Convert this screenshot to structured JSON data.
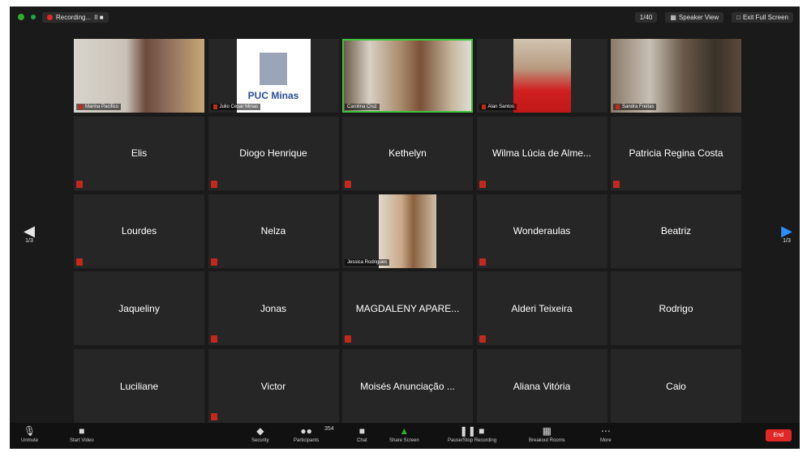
{
  "window": {
    "recording_label": "Recording...",
    "recording_controls": "II ■",
    "page_indicator": "1/40",
    "speaker_view_label": "Speaker View",
    "exit_full_screen_label": "Exit Full Screen"
  },
  "navigation": {
    "left_page": "1/3",
    "right_page": "1/3"
  },
  "participants": [
    {
      "name": "Marina Pacifico",
      "video": true
    },
    {
      "name": "Julio Cesar Minas",
      "video": true,
      "logo_text": "PUC Minas"
    },
    {
      "name": "Carolina Cruz",
      "video": true,
      "active_speaker": true
    },
    {
      "name": "Alan Santos",
      "video": true
    },
    {
      "name": "Sandra Freitas",
      "video": true
    },
    {
      "name": "Elis",
      "video": false
    },
    {
      "name": "Diogo Henrique",
      "video": false
    },
    {
      "name": "Kethelyn",
      "video": false
    },
    {
      "name": "Wilma Lúcia de Alme...",
      "video": false
    },
    {
      "name": "Patricia Regina Costa",
      "video": false
    },
    {
      "name": "Lourdes",
      "video": false
    },
    {
      "name": "Nelza",
      "video": false
    },
    {
      "name": "Jessica Rodrigues",
      "video": true
    },
    {
      "name": "Wonderaulas",
      "video": false
    },
    {
      "name": "Beatriz",
      "video": false
    },
    {
      "name": "Jaqueliny",
      "video": false
    },
    {
      "name": "Jonas",
      "video": false
    },
    {
      "name": "MAGDALENY APARE...",
      "video": false
    },
    {
      "name": "Alderi Teixeira",
      "video": false
    },
    {
      "name": "Rodrigo",
      "video": false
    },
    {
      "name": "Luciliane",
      "video": false
    },
    {
      "name": "Victor",
      "video": false
    },
    {
      "name": "Moisés Anunciação ...",
      "video": false
    },
    {
      "name": "Aliana Vitória",
      "video": false
    },
    {
      "name": "Caio",
      "video": false
    }
  ],
  "toolbar": {
    "unmute": "Unmute",
    "start_video": "Start Video",
    "security": "Security",
    "participants": "Participants",
    "participants_count": "354",
    "chat": "Chat",
    "share_screen": "Share Screen",
    "record": "Pause/Stop Recording",
    "breakout_rooms": "Breakout Rooms",
    "more": "More",
    "end": "End"
  },
  "colors": {
    "background": "#1a1a1a",
    "tile": "#262626",
    "active_speaker_border": "#3fc33f",
    "mute_red": "#c4281c",
    "share_green": "#2fae2f",
    "end_red": "#e02828",
    "nav_blue": "#2d8cff"
  }
}
